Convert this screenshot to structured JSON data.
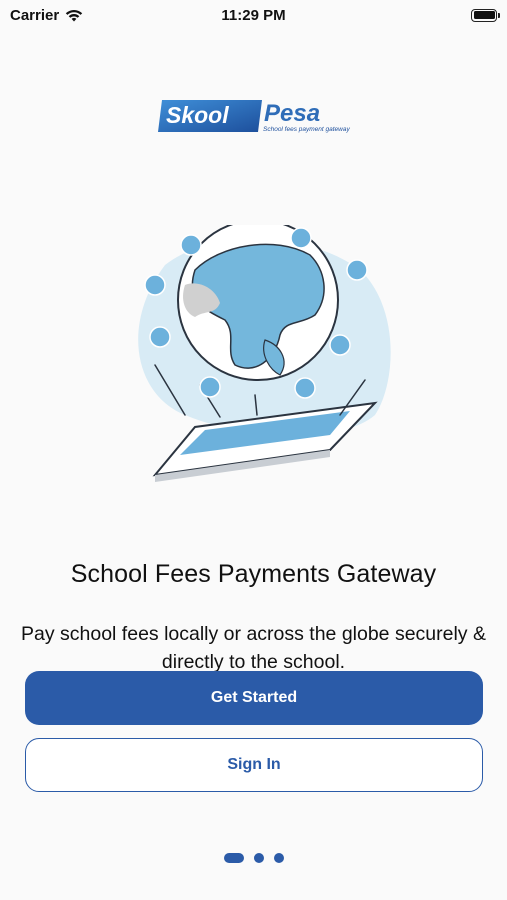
{
  "status_bar": {
    "carrier": "Carrier",
    "time": "11:29 PM"
  },
  "logo": {
    "brand_part1": "Skool",
    "brand_part2": "Pesa",
    "tagline": "School fees payment gateway"
  },
  "onboarding": {
    "title": "School Fees Payments Gateway",
    "description": "Pay school fees locally or across the globe securely & directly to the school."
  },
  "buttons": {
    "primary_label": "Get Started",
    "secondary_label": "Sign In"
  },
  "pager": {
    "total": 3,
    "active_index": 0
  },
  "colors": {
    "accent": "#2b5ba8",
    "background": "#fafafa"
  }
}
